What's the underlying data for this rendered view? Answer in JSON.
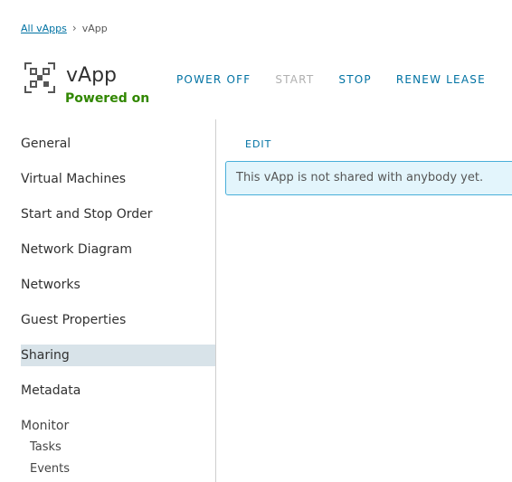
{
  "breadcrumb": {
    "parent": "All vApps",
    "current": "vApp"
  },
  "header": {
    "title": "vApp",
    "status": "Powered on",
    "status_color": "#318700"
  },
  "actions": {
    "power_off": "POWER OFF",
    "start": "START",
    "stop": "STOP",
    "renew_lease": "RENEW LEASE"
  },
  "sidebar": {
    "items": [
      {
        "label": "General"
      },
      {
        "label": "Virtual Machines"
      },
      {
        "label": "Start and Stop Order"
      },
      {
        "label": "Network Diagram"
      },
      {
        "label": "Networks"
      },
      {
        "label": "Guest Properties"
      },
      {
        "label": "Sharing",
        "active": true
      },
      {
        "label": "Metadata"
      }
    ],
    "monitor": {
      "label": "Monitor",
      "children": [
        {
          "label": "Tasks"
        },
        {
          "label": "Events"
        }
      ]
    }
  },
  "main": {
    "edit_label": "EDIT",
    "alert_text": "This vApp is not shared with anybody yet."
  },
  "icons": {
    "app": "vapp-grid-icon",
    "breadcrumb_separator": "chevron-right-icon"
  },
  "colors": {
    "link": "#0072a3",
    "active_bg": "#d8e3e9",
    "alert_bg": "#e3f5fc",
    "alert_border": "#49afd9"
  }
}
